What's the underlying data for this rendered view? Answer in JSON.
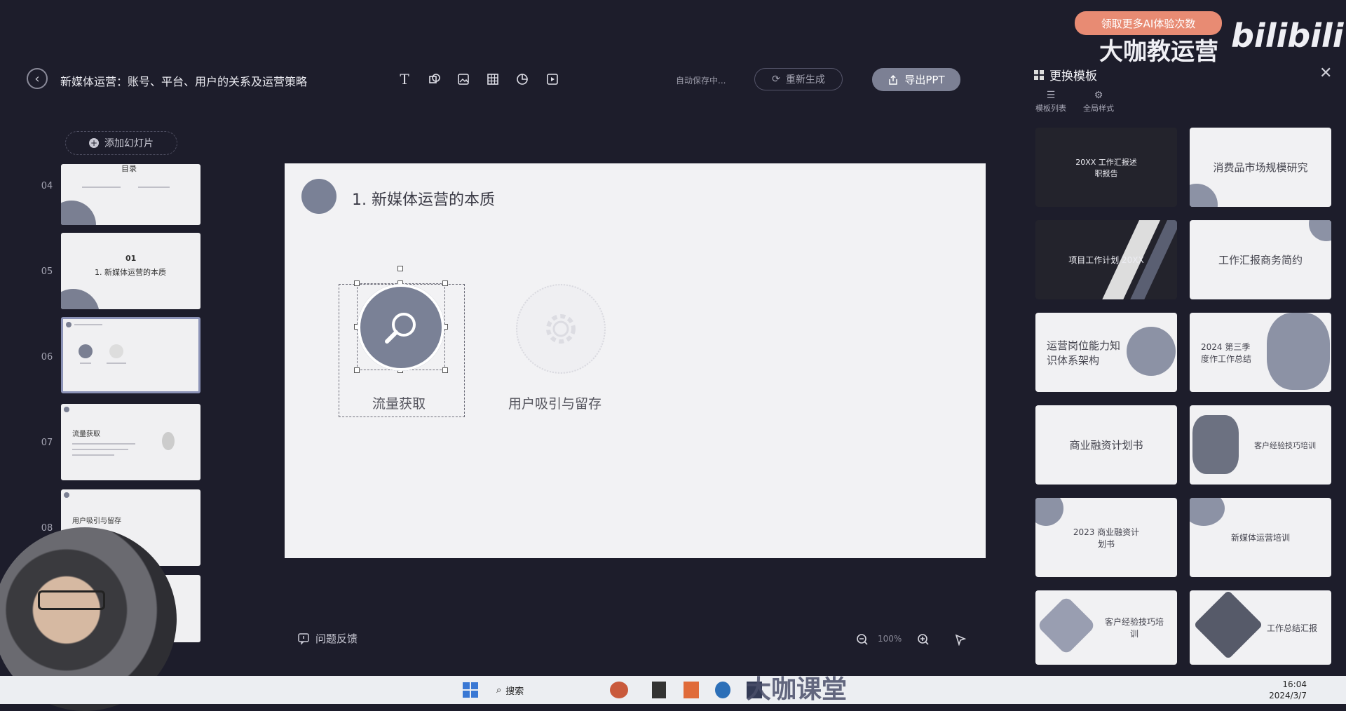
{
  "header": {
    "back_icon": "chevron-left-icon",
    "doc_title": "新媒体运营：账号、平台、用户的关系及运营策略",
    "tools": [
      "text-icon",
      "shape-icon",
      "image-icon",
      "table-icon",
      "chart-icon",
      "media-icon"
    ],
    "autosave": "自动保存中...",
    "regenerate": "重新生成",
    "export": "导出PPT"
  },
  "sidebar": {
    "add_slide": "添加幻灯片",
    "slides": [
      {
        "num": "04",
        "title": "目录"
      },
      {
        "num": "05",
        "title_num": "01",
        "title": "1. 新媒体运营的本质"
      },
      {
        "num": "06",
        "title": ""
      },
      {
        "num": "07",
        "title": "流量获取"
      },
      {
        "num": "08",
        "title": "用户吸引与留存"
      }
    ]
  },
  "slide": {
    "title": "1. 新媒体运营的本质",
    "items": [
      {
        "label": "流量获取",
        "icon": "search-icon"
      },
      {
        "label": "用户吸引与留存",
        "icon": "gear-icon"
      }
    ]
  },
  "footer": {
    "feedback": "问题反馈",
    "zoom": "100%"
  },
  "panel": {
    "title": "更换模板",
    "tabs": [
      "模板列表",
      "全局样式"
    ],
    "templates": [
      {
        "label": "20XX 工作汇报述职报告"
      },
      {
        "label": "消费品市场规模研究"
      },
      {
        "label": "项目工作计划 20XX"
      },
      {
        "label": "工作汇报商务简约"
      },
      {
        "label": "运营岗位能力知识体系架构"
      },
      {
        "label": "2024 第三季度作工作总结"
      },
      {
        "label": "商业融资计划书"
      },
      {
        "label": "客户经验技巧培训"
      },
      {
        "label": "2023 商业融资计划书"
      },
      {
        "label": "新媒体运营培训"
      },
      {
        "label": "客户经验技巧培训"
      },
      {
        "label": "工作总结汇报"
      }
    ]
  },
  "overlay": {
    "promo": "领取更多AI体验次数",
    "brand": "大咖教运营",
    "platform_logo": "bilibili",
    "watermark": "大咖课堂"
  },
  "taskbar": {
    "search": "搜索",
    "time": "16:04",
    "date": "2024/3/7"
  }
}
